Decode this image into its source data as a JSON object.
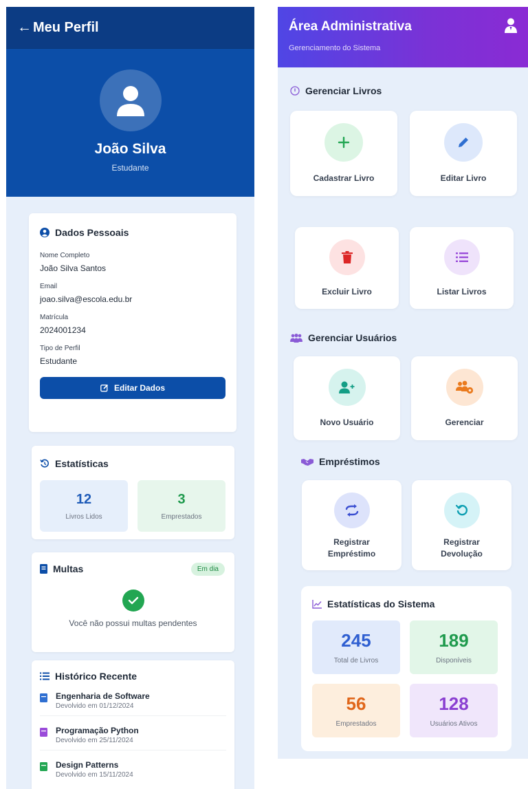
{
  "profile": {
    "back_arrow": "←",
    "title": "Meu Perfil",
    "name": "João Silva",
    "role": "Estudante"
  },
  "personal": {
    "title": "Dados Pessoais",
    "fields": [
      {
        "label": "Nome Completo",
        "value": "João Silva Santos"
      },
      {
        "label": "Email",
        "value": "joao.silva@escola.edu.br"
      },
      {
        "label": "Matrícula",
        "value": "2024001234"
      },
      {
        "label": "Tipo de Perfil",
        "value": "Estudante"
      }
    ],
    "edit_label": "Editar Dados"
  },
  "stats": {
    "title": "Estatísticas",
    "items": [
      {
        "value": "12",
        "label": "Livros Lidos",
        "color": "#1e5bb8",
        "bg": "#e6effb"
      },
      {
        "value": "3",
        "label": "Emprestados",
        "color": "#1f9a4d",
        "bg": "#e7f6ec"
      }
    ]
  },
  "fines": {
    "title": "Multas",
    "badge": "Em dia",
    "message": "Você não possui multas pendentes"
  },
  "history": {
    "title": "Histórico Recente",
    "items": [
      {
        "title": "Engenharia de Software",
        "subtitle": "Devolvido em 01/12/2024",
        "color": "#2f6fd1"
      },
      {
        "title": "Programação Python",
        "subtitle": "Devolvido em 25/11/2024",
        "color": "#9a4bd9"
      },
      {
        "title": "Design Patterns",
        "subtitle": "Devolvido em 15/11/2024",
        "color": "#22a652"
      }
    ]
  },
  "admin": {
    "title": "Área Administrativa",
    "subtitle": "Gerenciamento do Sistema",
    "books_section": "Gerenciar Livros",
    "books_actions": [
      {
        "label": "Cadastrar Livro",
        "icon": "plus-icon",
        "bg": "#dcf5e4",
        "color": "#22a652"
      },
      {
        "label": "Editar Livro",
        "icon": "pencil-icon",
        "bg": "#dde8fb",
        "color": "#2f6fd1"
      },
      {
        "label": "Excluir Livro",
        "icon": "trash-icon",
        "bg": "#fde2e2",
        "color": "#dc2626"
      },
      {
        "label": "Listar Livros",
        "icon": "list-icon",
        "bg": "#efe3fb",
        "color": "#9a4bd9"
      }
    ],
    "users_section": "Gerenciar Usuários",
    "users_actions": [
      {
        "label": "Novo Usuário",
        "icon": "user-plus-icon",
        "bg": "#d6f3ee",
        "color": "#149e86"
      },
      {
        "label": "Gerenciar",
        "icon": "users-gear-icon",
        "bg": "#fde6d3",
        "color": "#ea7a1d"
      }
    ],
    "loans_section": "Empréstimos",
    "loans_actions": [
      {
        "label1": "Registrar",
        "label2": "Empréstimo",
        "icon": "exchange-icon",
        "bg": "#dde3fb",
        "color": "#3b4fd1"
      },
      {
        "label1": "Registrar",
        "label2": "Devolução",
        "icon": "undo-icon",
        "bg": "#d5f3f7",
        "color": "#0e9fb2"
      }
    ],
    "system_title": "Estatísticas do Sistema",
    "system_stats": [
      {
        "value": "245",
        "label": "Total de Livros",
        "color": "#2f5fd1",
        "bg": "#e1eafb"
      },
      {
        "value": "189",
        "label": "Disponíveis",
        "color": "#1f9a4d",
        "bg": "#e2f6e8"
      },
      {
        "value": "56",
        "label": "Emprestados",
        "color": "#e0661a",
        "bg": "#fdeedd"
      },
      {
        "value": "128",
        "label": "Usuários Ativos",
        "color": "#8a3fd1",
        "bg": "#f0e6fb"
      }
    ]
  }
}
